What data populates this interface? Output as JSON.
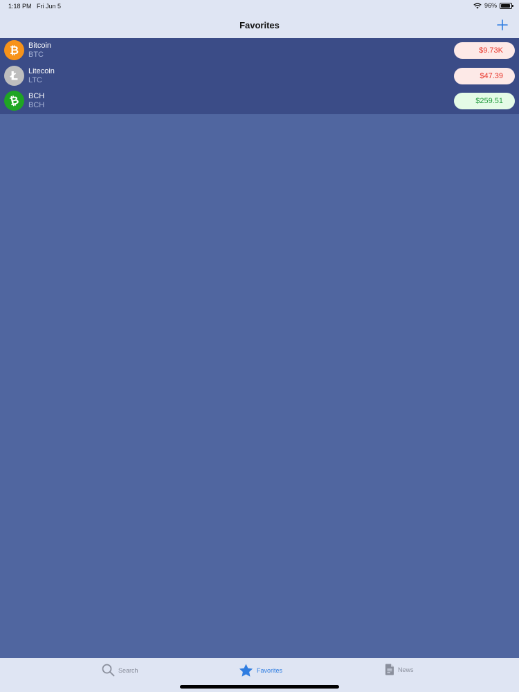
{
  "status": {
    "time": "1:18 PM",
    "date": "Fri Jun 5",
    "battery": "96%",
    "battery_level": 0.96
  },
  "nav": {
    "title": "Favorites",
    "add_icon": "plus-icon"
  },
  "coins": [
    {
      "name": "Bitcoin",
      "symbol": "BTC",
      "price": "$9.73K",
      "trend": "down",
      "icon": "bitcoin-icon",
      "icon_glyph": "₿",
      "icon_color": "#f7931a"
    },
    {
      "name": "Litecoin",
      "symbol": "LTC",
      "price": "$47.39",
      "trend": "down",
      "icon": "litecoin-icon",
      "icon_glyph": "Ł",
      "icon_color": "#bebebe"
    },
    {
      "name": "BCH",
      "symbol": "BCH",
      "price": "$259.51",
      "trend": "up",
      "icon": "bitcoin-cash-icon",
      "icon_glyph": "₿",
      "icon_color": "#1fa524"
    }
  ],
  "tabs": [
    {
      "label": "Search",
      "icon": "magnifier-icon",
      "active": false
    },
    {
      "label": "Favorites",
      "icon": "star-icon",
      "active": true
    },
    {
      "label": "News",
      "icon": "document-icon",
      "active": false
    }
  ],
  "colors": {
    "bar_background": "#dfe5f3",
    "list_background": "#3b4c87",
    "page_background": "#5066a0",
    "accent": "#2f7de1",
    "price_down_text": "#e8352b",
    "price_down_bg": "#fde9e7",
    "price_up_text": "#1f9a3c",
    "price_up_bg": "#e4fbe6"
  }
}
